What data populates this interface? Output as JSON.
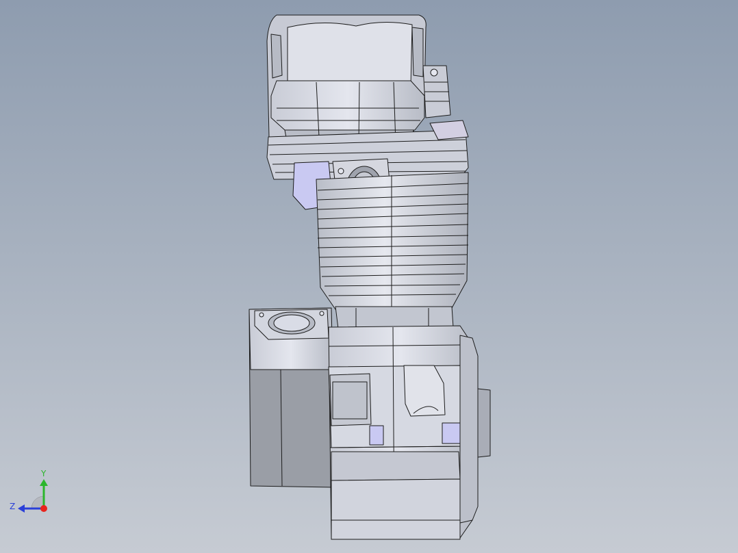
{
  "viewport": {
    "background_top": "#8e9caf",
    "background_bottom": "#c6cbd3"
  },
  "model": {
    "face_light": "#d9dce6",
    "face_mid": "#c4c8d3",
    "face_dark": "#9a9ea6",
    "highlight": "#eef0f6",
    "accent_face": "#c9c9f2",
    "edge": "#1b1b1b"
  },
  "triad": {
    "y_label": "Y",
    "z_label": "Z",
    "x_color": "#e8241d",
    "y_color": "#2bb62b",
    "z_color": "#2a3fd8"
  }
}
